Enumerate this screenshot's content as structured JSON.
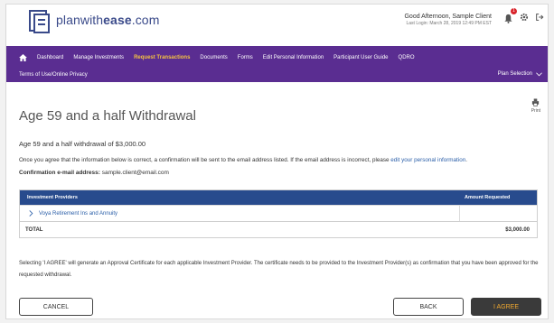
{
  "header": {
    "brand_prefix": "planwith",
    "brand_bold": "ease",
    "brand_suffix": ".com",
    "greeting": "Good Afternoon, Sample Client",
    "last_login": "Last Login: March 28, 2019 12:49 PM EST",
    "notification_count": "1"
  },
  "nav": {
    "items": [
      "Dashboard",
      "Manage Investments",
      "Request Transactions",
      "Documents",
      "Forms",
      "Edit Personal Information",
      "Participant User Guide",
      "QDRO"
    ],
    "terms": "Terms of Use/Online Privacy",
    "plan_selection": "Plan Selection"
  },
  "page": {
    "title": "Age 59 and a half Withdrawal",
    "print_label": "Print",
    "subhead": "Age 59 and a half withdrawal of $3,000.00",
    "info_text": "Once you agree that the information below is correct, a confirmation will be sent to the email address listed. If the email address is incorrect, please ",
    "info_link": "edit your personal information",
    "info_end": ".",
    "conf_label": "Confirmation e-mail address:",
    "conf_email": "sample.client@email.com"
  },
  "table": {
    "col_provider": "Investment Providers",
    "col_amount": "Amount Requested",
    "provider": "Voya Retirement Ins and Annuity",
    "total_label": "TOTAL",
    "total_amount": "$3,000.00"
  },
  "notice": "Selecting 'I AGREE' will generate an Approval Certificate for each applicable Investment Provider. The certificate needs to be provided to the Investment Provider(s) as confirmation that you have been approved for the requested withdrawal.",
  "buttons": {
    "cancel": "CANCEL",
    "back": "BACK",
    "agree": "I AGREE"
  },
  "colors": {
    "nav_bg": "#5a2d91",
    "nav_active": "#f5c242",
    "table_header": "#284b8d",
    "agree_text": "#f0a830"
  }
}
